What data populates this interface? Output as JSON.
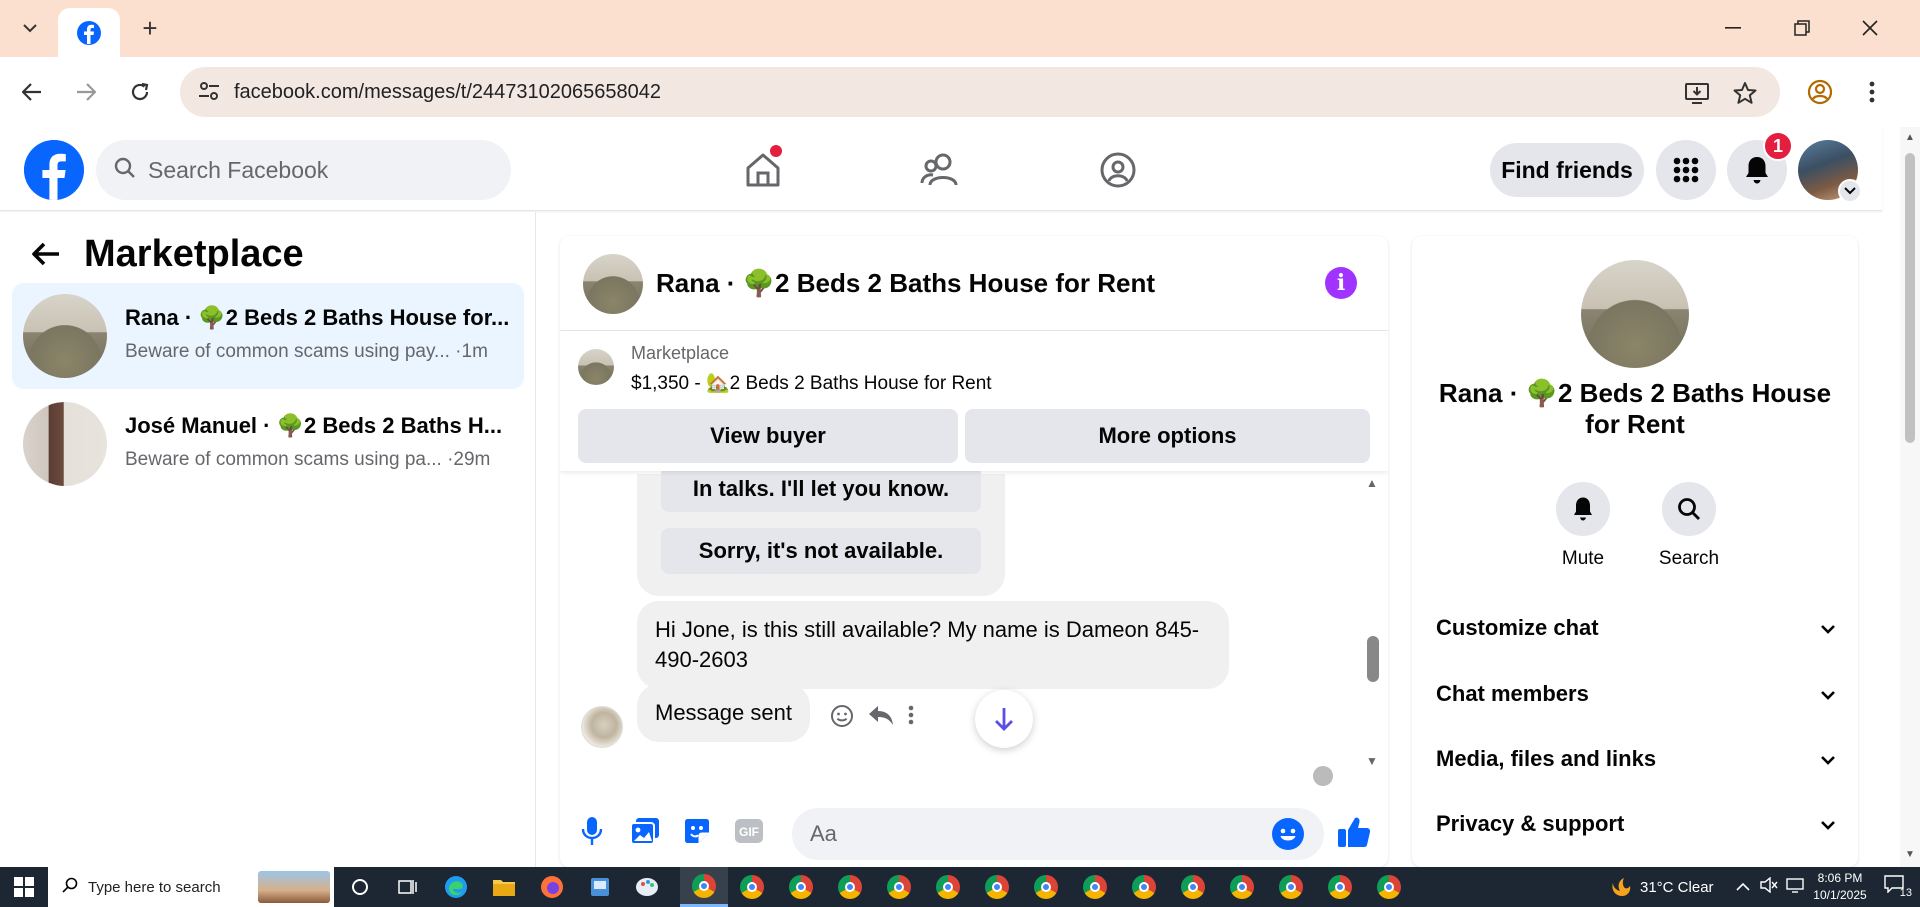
{
  "browser": {
    "url": "facebook.com/messages/t/24473102065658042"
  },
  "header": {
    "search_placeholder": "Search Facebook",
    "find_friends_label": "Find friends",
    "notification_count": "1"
  },
  "sidebar": {
    "title": "Marketplace",
    "conversations": [
      {
        "name": "Rana · 🌳2 Beds 2 Baths House for...",
        "preview": "Beware of common scams using pay... ·1m",
        "active": true
      },
      {
        "name": "José Manuel · 🌳2 Beds 2 Baths H...",
        "preview": "Beware of common scams using pa... ·29m",
        "active": false
      }
    ]
  },
  "chat": {
    "title": "Rana · 🌳2 Beds 2 Baths House for Rent",
    "listing": {
      "source": "Marketplace",
      "price_line": "$1,350 - 🏡2 Beds 2 Baths House for Rent",
      "view_buyer_label": "View buyer",
      "more_options_label": "More options"
    },
    "quick_replies": [
      "In talks. I'll let you know.",
      "Sorry, it's not available."
    ],
    "messages": [
      {
        "text": "Hi Jone, is this still available? My name is Dameon 845-490-2603"
      },
      {
        "text": "Message sent"
      }
    ],
    "composer_placeholder": "Aa"
  },
  "info_panel": {
    "title": "Rana · 🌳2 Beds 2 Baths House for Rent",
    "actions": [
      {
        "label": "Mute",
        "icon": "bell-icon"
      },
      {
        "label": "Search",
        "icon": "search-icon"
      }
    ],
    "sections": [
      "Customize chat",
      "Chat members",
      "Media, files and links",
      "Privacy & support"
    ]
  },
  "taskbar": {
    "search_placeholder": "Type here to search",
    "weather": "31°C  Clear",
    "time": "8:06 PM",
    "date": "10/1/2025",
    "notifications": "13"
  },
  "colors": {
    "facebook_blue": "#0866ff",
    "messenger_purple": "#a033ff",
    "titlebar": "#fbe0cf",
    "notification_red": "#e41e3f"
  }
}
